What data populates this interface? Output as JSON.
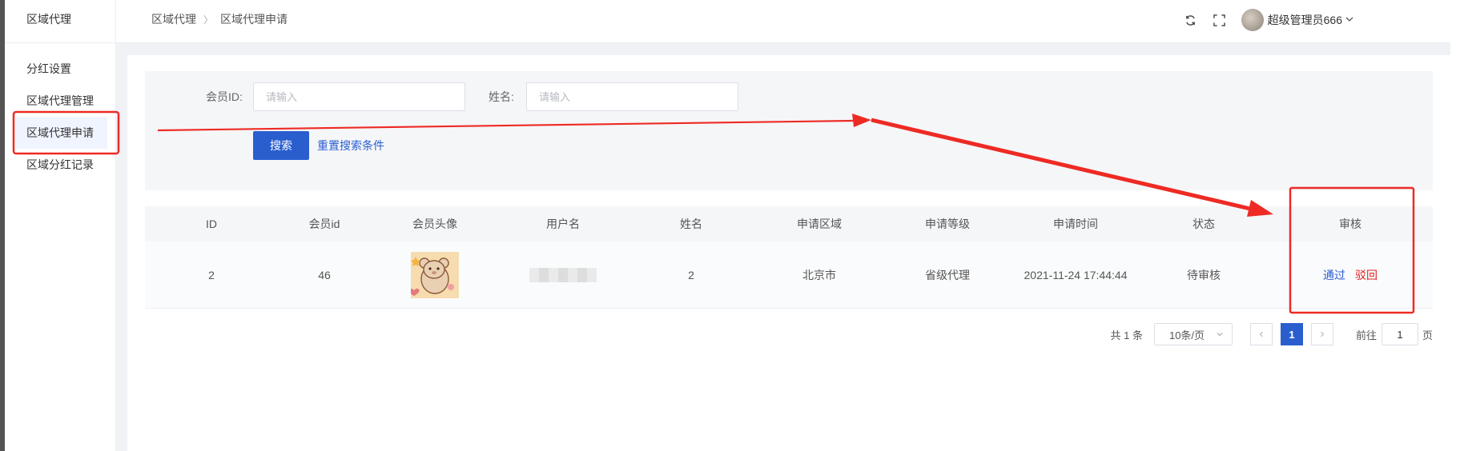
{
  "sidebar": {
    "title": "区域代理",
    "items": [
      {
        "label": "分红设置"
      },
      {
        "label": "区域代理管理"
      },
      {
        "label": "区域代理申请",
        "active": true
      },
      {
        "label": "区域分红记录"
      }
    ]
  },
  "breadcrumb": {
    "level1": "区域代理",
    "level2": "区域代理申请"
  },
  "header": {
    "user_name": "超级管理员666",
    "icons": [
      "refresh-icon",
      "fullscreen-icon",
      "chevron-down-icon"
    ]
  },
  "search": {
    "member_id_label": "会员ID:",
    "member_id_placeholder": "请输入",
    "name_label": "姓名:",
    "name_placeholder": "请输入",
    "search_button": "搜索",
    "reset_link": "重置搜索条件"
  },
  "table": {
    "columns": [
      "ID",
      "会员id",
      "会员头像",
      "用户名",
      "姓名",
      "申请区域",
      "申请等级",
      "申请时间",
      "状态",
      "审核"
    ],
    "rows": [
      {
        "id": "2",
        "member_id": "46",
        "username": "",
        "name": "2",
        "region": "北京市",
        "level": "省级代理",
        "time": "2021-11-24 17:44:44",
        "status": "待审核",
        "approve": "通过",
        "reject": "驳回"
      }
    ]
  },
  "pagination": {
    "total": "共 1 条",
    "page_size": "10条/页",
    "current_page": "1",
    "goto_label": "前往",
    "goto_value": "1",
    "goto_suffix": "页"
  },
  "colors": {
    "primary": "#2a5ecf",
    "danger": "#e02020",
    "annotation": "#ee2a24"
  }
}
